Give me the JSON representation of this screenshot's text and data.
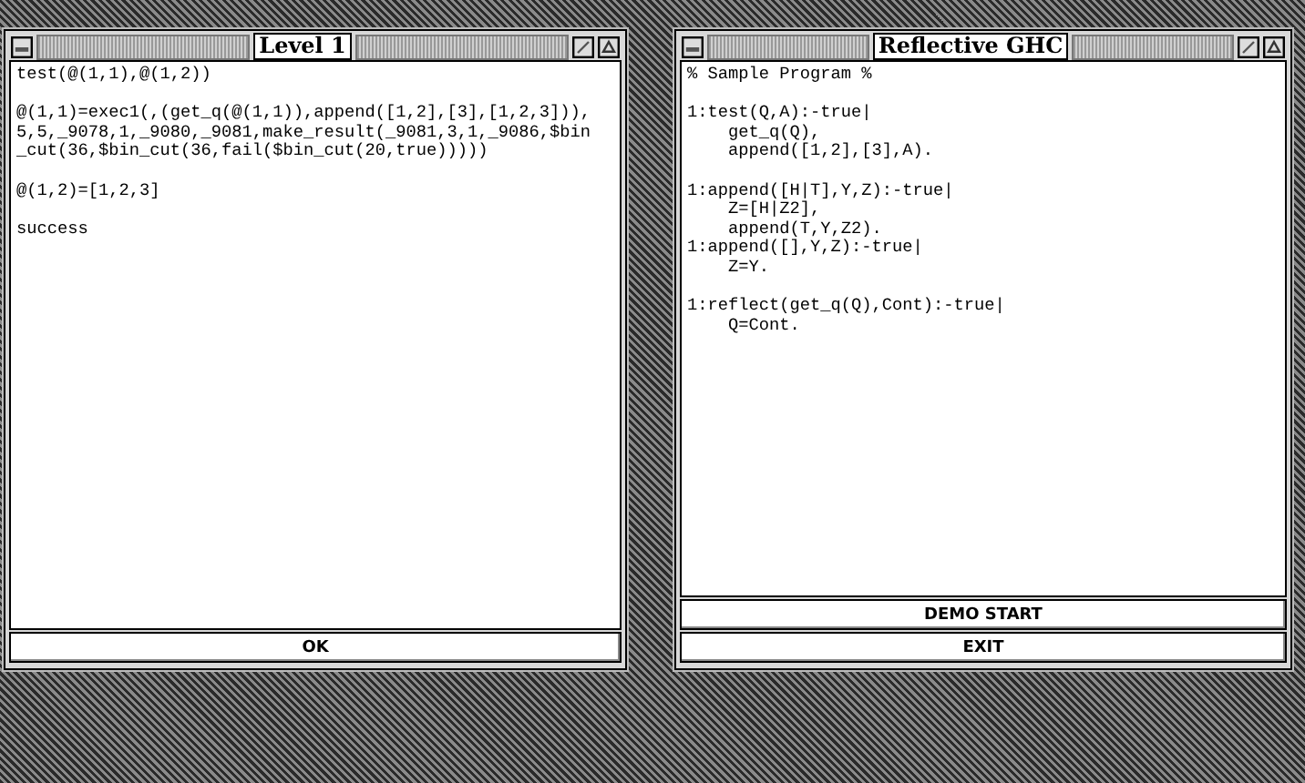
{
  "windows": [
    {
      "title": "Level 1",
      "blocks": [
        [
          "test(@(1,1),@(1,2))"
        ],
        [
          "@(1,1)=exec1(,(get_q(@(1,1)),append([1,2],[3],[1,2,3])),",
          "5,5,_9078,1,_9080,_9081,make_result(_9081,3,1,_9086,$bin",
          "_cut(36,$bin_cut(36,fail($bin_cut(20,true)))))"
        ],
        [
          "@(1,2)=[1,2,3]"
        ],
        [
          "success"
        ]
      ],
      "buttons": [
        "OK"
      ]
    },
    {
      "title": "Reflective GHC",
      "blocks": [
        [
          "% Sample Program %"
        ],
        [
          "1:test(Q,A):-true|",
          "    get_q(Q),",
          "    append([1,2],[3],A)."
        ],
        [
          "1:append([H|T],Y,Z):-true|",
          "    Z=[H|Z2],",
          "    append(T,Y,Z2).",
          "1:append([],Y,Z):-true|",
          "    Z=Y."
        ],
        [
          "1:reflect(get_q(Q),Cont):-true|",
          "    Q=Cont."
        ]
      ],
      "buttons": [
        "DEMO START",
        "EXIT"
      ]
    }
  ]
}
